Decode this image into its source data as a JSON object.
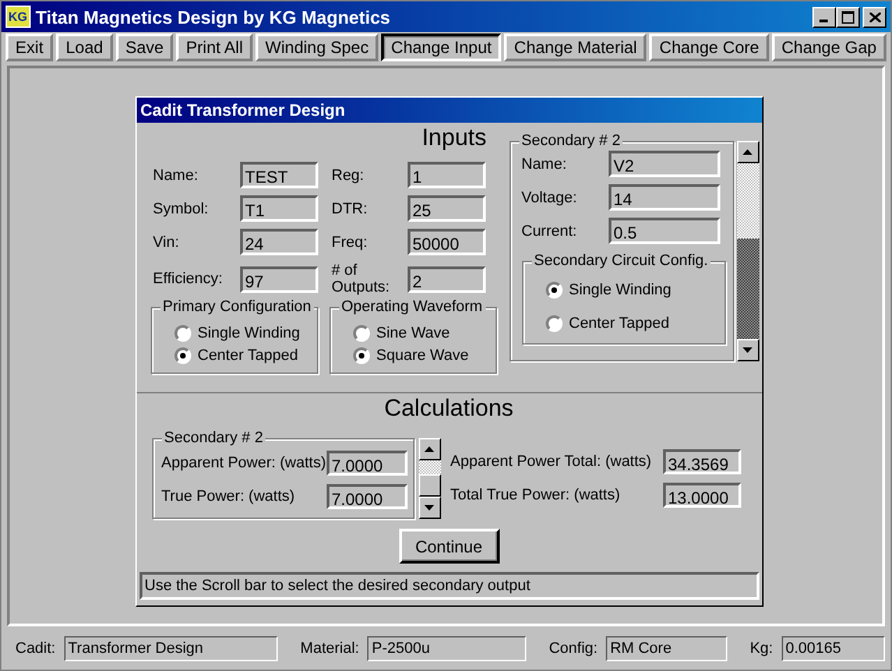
{
  "window": {
    "title": "Titan Magnetics Design by KG Magnetics",
    "logo": "KG"
  },
  "toolbar": [
    {
      "label": "Exit",
      "selected": false
    },
    {
      "label": "Load",
      "selected": false
    },
    {
      "label": "Save",
      "selected": false
    },
    {
      "label": "Print All",
      "selected": false
    },
    {
      "label": "Winding Spec",
      "selected": false
    },
    {
      "label": "Change Input",
      "selected": true
    },
    {
      "label": "Change Material",
      "selected": false
    },
    {
      "label": "Change Core",
      "selected": false
    },
    {
      "label": "Change Gap",
      "selected": false
    }
  ],
  "dialog": {
    "title": "Cadit Transformer Design",
    "inputs": {
      "heading": "Inputs",
      "fields": [
        {
          "label": "Name:",
          "value": "TEST"
        },
        {
          "label": "Reg:",
          "value": "1"
        },
        {
          "label": "Symbol:",
          "value": "T1"
        },
        {
          "label": "DTR:",
          "value": "25"
        },
        {
          "label": "Vin:",
          "value": "24"
        },
        {
          "label": "Freq:",
          "value": "50000"
        },
        {
          "label": "Efficiency:",
          "value": "97"
        },
        {
          "label": "# of Outputs:",
          "value": "2"
        }
      ],
      "groups": [
        {
          "title": "Primary Configuration",
          "options": [
            {
              "label": "Single Winding",
              "selected": false
            },
            {
              "label": "Center Tapped",
              "selected": true
            }
          ]
        },
        {
          "title": "Operating Waveform",
          "options": [
            {
              "label": "Sine Wave",
              "selected": false
            },
            {
              "label": "Square Wave",
              "selected": true
            }
          ]
        }
      ],
      "secondary": {
        "title": "Secondary #  2",
        "fields": [
          {
            "label": "Name:",
            "value": "V2"
          },
          {
            "label": "Voltage:",
            "value": "14"
          },
          {
            "label": "Current:",
            "value": "0.5"
          }
        ],
        "config": {
          "title": "Secondary Circuit Config.",
          "options": [
            {
              "label": "Single Winding",
              "selected": true
            },
            {
              "label": "Center Tapped",
              "selected": false
            }
          ]
        }
      }
    },
    "calculations": {
      "heading": "Calculations",
      "secondary": {
        "title": "Secondary # 2",
        "fields": [
          {
            "label": "Apparent Power: (watts)",
            "value": "7.0000"
          },
          {
            "label": "True Power: (watts)",
            "value": "7.0000"
          }
        ]
      },
      "totals": [
        {
          "label": "Apparent Power Total: (watts)",
          "value": "34.3569"
        },
        {
          "label": "Total True Power: (watts)",
          "value": "13.0000"
        }
      ]
    },
    "continue_button": "Continue",
    "hint": "Use the Scroll bar to select the desired secondary output"
  },
  "status_bar": [
    {
      "label": "Cadit:",
      "value": "Transformer Design"
    },
    {
      "label": "Material:",
      "value": "P-2500u"
    },
    {
      "label": "Config:",
      "value": "RM Core"
    },
    {
      "label": "Kg:",
      "value": "0.00165"
    }
  ]
}
